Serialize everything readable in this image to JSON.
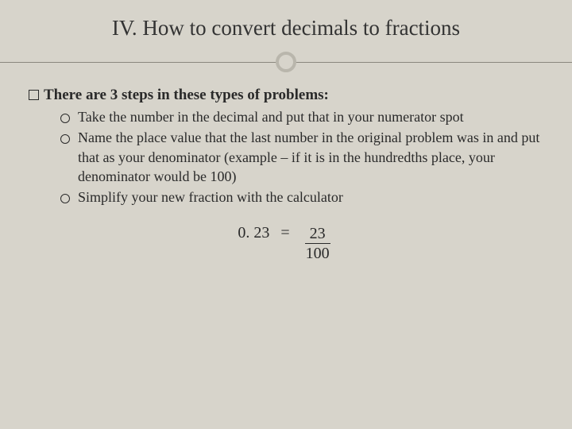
{
  "title": "IV.  How to convert decimals to fractions",
  "intro": "There are 3 steps in these types of problems:",
  "steps": [
    "Take the number in the decimal and put that in your numerator spot",
    "Name the place value that the last number in the original problem was in and put that as your denominator (example – if it is in the hundredths place, your denominator would be 100)",
    "Simplify your new fraction with the calculator"
  ],
  "example": {
    "lhs": "0. 23",
    "eq": "=",
    "numerator": "23",
    "denominator": "100"
  }
}
